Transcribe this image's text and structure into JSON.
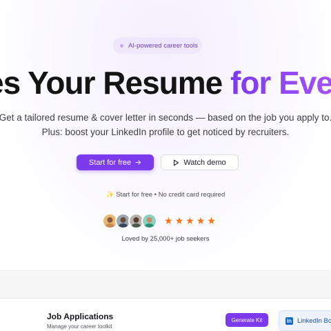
{
  "hero": {
    "badge": "AI-powered career tools",
    "headline_main": "es Your Resume ",
    "headline_accent": "for Ever",
    "subtitle_line1": "Get a tailored resume & cover letter in seconds — based on the job you apply to.",
    "subtitle_line2": "Plus: boost your LinkedIn profile to get noticed by recruiters.",
    "primary_button": "Start for free",
    "secondary_button": "Watch demo",
    "note": "✨ Start for free • No credit card required",
    "rating_stars": 5,
    "social_proof": "Loved by 25,000+ job seekers"
  },
  "dashboard": {
    "title": "Job Applications",
    "subtitle": "Manage your career toolkit",
    "generate_button": "Generate Kit",
    "linkedin_chip": "LinkedIn Bo"
  },
  "colors": {
    "accent": "#7c3aed",
    "star": "#f97316",
    "linkedin": "#1a66c2"
  }
}
